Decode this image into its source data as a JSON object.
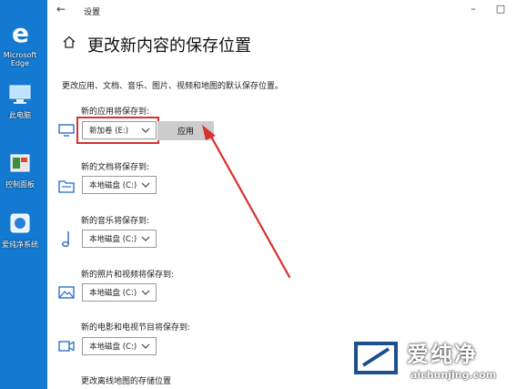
{
  "desktop": {
    "icons": [
      {
        "label": "Microsoft Edge",
        "icon": "edge-icon"
      },
      {
        "label": "此电脑",
        "icon": "computer-icon"
      },
      {
        "label": "控制面板",
        "icon": "program-icon"
      },
      {
        "label": "爱纯净系统",
        "icon": "app-icon"
      }
    ]
  },
  "window": {
    "title": "设置",
    "back_icon": "back-arrow-icon",
    "controls": [
      "minimize",
      "maximize"
    ]
  },
  "page": {
    "title": "更改新内容的保存位置",
    "description": "更改应用、文档、音乐、图片、视频和地图的默认保存位置。",
    "apply_label": "应用",
    "sections": [
      {
        "label": "新的应用将保存到:",
        "drive": "新加卷 (E:)",
        "icon": "monitor-icon"
      },
      {
        "label": "新的文档将保存到:",
        "drive": "本地磁盘 (C:)",
        "icon": "folder-icon"
      },
      {
        "label": "新的音乐将保存到:",
        "drive": "本地磁盘 (C:)",
        "icon": "music-note-icon"
      },
      {
        "label": "新的照片和视频将保存到:",
        "drive": "本地磁盘 (C:)",
        "icon": "image-icon"
      },
      {
        "label": "新的电影和电视节目将保存到:",
        "drive": "本地磁盘 (C:)",
        "icon": "video-camera-icon"
      }
    ],
    "offline_maps_label": "更改离线地图的存储位置"
  },
  "annotation_color": "#d93030",
  "watermark": {
    "brand": "爱纯净",
    "site": "aichunjing.com"
  }
}
